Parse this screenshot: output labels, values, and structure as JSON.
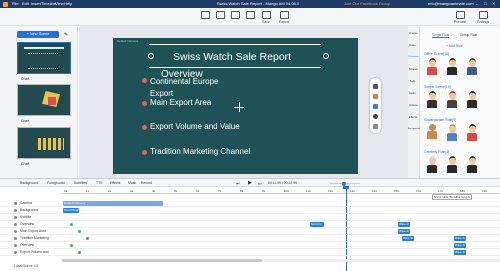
{
  "window": {
    "menus": [
      "File",
      "Edit",
      "Insert",
      "Timeline",
      "View",
      "Help"
    ],
    "title": "Swiss Watch Sale Report - Mango AM 04.08.0",
    "feedback": "Join Our Facebook Group",
    "email": "eric@mangoanimate.com"
  },
  "toolbar": {
    "center": [
      "Save",
      "Export"
    ],
    "right": [
      "Preview",
      "Settings"
    ]
  },
  "left_panel": {
    "new_scene": "+ New Scene",
    "scenes": [
      "Chart",
      "Chart",
      "Chart"
    ]
  },
  "slide": {
    "label": "Default Camera",
    "title": "Swiss Watch Sale Report",
    "overlap_text": "Overview",
    "bullets": [
      "Continental Europe Export",
      "Main Export Area",
      "Export Volume and Value",
      "Tradition Marketing Channel"
    ]
  },
  "right_panel": {
    "tabs": [
      "Single Role",
      "Group Role"
    ],
    "add_role": "Add Role",
    "groups": [
      "Office Scene[16]",
      "Simple Scene[16]",
      "Kindergarden Role[9]",
      "Celebrity Role[4]"
    ],
    "side_icons": [
      "Images",
      "Video",
      "Characters",
      "Shapes",
      "SVG",
      "Audio",
      "Actions",
      "Effects",
      "Background"
    ]
  },
  "timeline": {
    "toolbar": [
      "Background",
      "Foreground",
      "Subtitles",
      "TTS",
      "Effects",
      "Mask",
      "Record"
    ],
    "time": "00:11.00 / 00:22.00",
    "tooltip": "Show Hide Timeline length",
    "rows": [
      "Camera",
      "Background",
      "Subtitle",
      "Overview",
      "Main Export Area",
      "Tradition Marketing",
      "Overview",
      "Export Volume and"
    ],
    "ruler": [
      "0s",
      "1s",
      "2s",
      "3s",
      "4s",
      "5s",
      "6s",
      "7s",
      "8s",
      "9s",
      "10s",
      "11s",
      "12s",
      "13s",
      "14s",
      "15s",
      "16s",
      "17s",
      "18s",
      "19s"
    ],
    "camera_clip": "Default Camera",
    "bg_clip": "Scroll Bright",
    "clip_labels": [
      "Scroll In",
      "Wipe In",
      "Wipe In",
      "Wipe In",
      "Wipe In",
      "Wipe In",
      "Wipe In"
    ],
    "footer": "Local Scene 1/1"
  },
  "colors": {
    "titlebar": "#1e3a66",
    "slide_bg": "#1f5257",
    "bullet": "#e0606a",
    "accent": "#2a6edb",
    "clip": "#2c7fd0"
  }
}
